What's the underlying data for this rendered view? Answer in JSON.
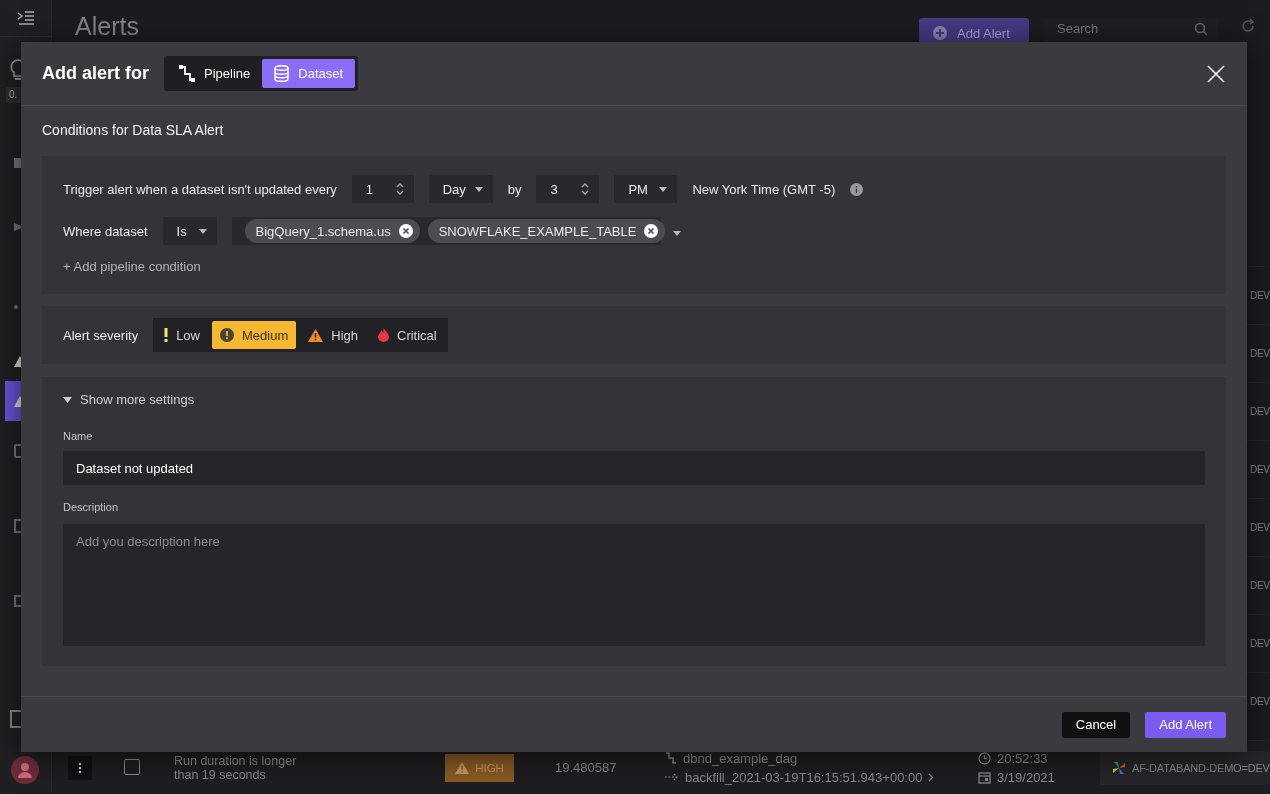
{
  "sidebar": {
    "badge": "0.",
    "items": [
      {
        "selected": false
      },
      {
        "selected": false
      },
      {
        "selected": false
      },
      {
        "selected": false
      },
      {
        "selected": true
      },
      {
        "selected": false
      },
      {
        "selected": false
      },
      {
        "selected": false
      }
    ]
  },
  "page": {
    "title": "Alerts",
    "add_button": "Add Alert",
    "search": {
      "placeholder": "Search"
    }
  },
  "table": {
    "rows": [
      {
        "environment": "DEV"
      },
      {
        "environment": "DEV"
      },
      {
        "environment": "DEV"
      },
      {
        "environment": "DEV"
      },
      {
        "environment": "DEV"
      },
      {
        "environment": "DEV"
      },
      {
        "environment": "DEV"
      },
      {
        "environment": "DEV"
      }
    ],
    "last_row": {
      "checked": false,
      "description": "Run duration is longer than 19 seconds",
      "severity": "HIGH",
      "value": "19.480587",
      "pipeline": "dbnd_example_dag",
      "run": "backfill_2021-03-19T16:15:51.943+00:00",
      "time": "20:52:33",
      "date": "3/19/2021",
      "environment": "AF-DATABAND-DEMO=DEV"
    }
  },
  "modal": {
    "title": "Add alert for",
    "targets": [
      {
        "label": "Pipeline",
        "kind": "pipeline",
        "selected": false
      },
      {
        "label": "Dataset",
        "kind": "dataset",
        "selected": true
      }
    ],
    "section_title": "Conditions for Data SLA Alert",
    "trigger": {
      "label": "Trigger alert when a dataset isn't updated every",
      "every": "1",
      "unit": "Day",
      "by_label": "by",
      "hour": "3",
      "period": "PM",
      "timezone": "New York Time (GMT -5)"
    },
    "where": {
      "label": "Where dataset",
      "operator": "Is",
      "values": [
        "BigQuery_1.schema.us",
        "SNOWFLAKE_EXAMPLE_TABLE"
      ]
    },
    "add_condition": "+ Add pipeline condition",
    "severity": {
      "label": "Alert severity",
      "options": [
        {
          "label": "Low",
          "kind": "low",
          "selected": false
        },
        {
          "label": "Medium",
          "kind": "medium",
          "selected": true
        },
        {
          "label": "High",
          "kind": "high",
          "selected": false
        },
        {
          "label": "Critical",
          "kind": "critical",
          "selected": false
        }
      ]
    },
    "more_settings": {
      "toggle": "Show more settings",
      "expanded": true,
      "name_label": "Name",
      "name_value": "Dataset not updated",
      "description_label": "Description",
      "description_placeholder": "Add you description here"
    },
    "buttons": [
      {
        "label": "Cancel",
        "kind": "secondary"
      },
      {
        "label": "Add Alert",
        "kind": "primary"
      }
    ]
  }
}
